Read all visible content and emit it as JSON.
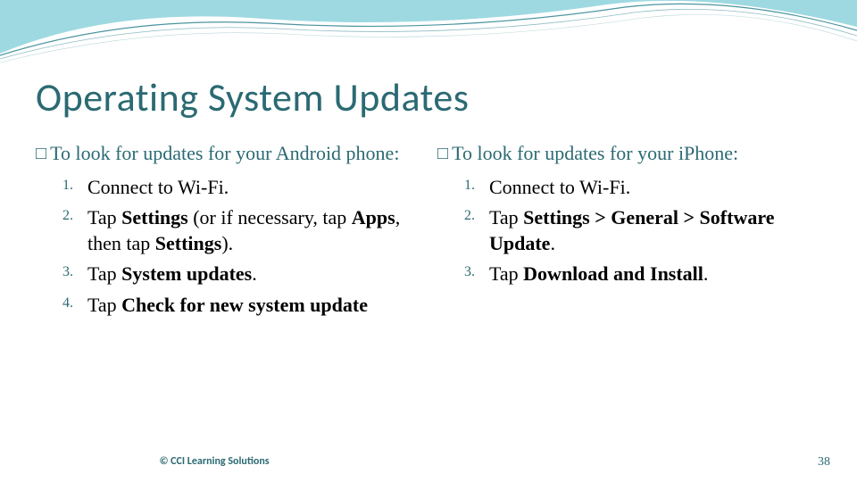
{
  "title": "Operating System Updates",
  "bullet_glyph": "□",
  "left": {
    "intro": "To look for updates for your Android phone:",
    "steps_html": [
      "Connect to Wi-Fi.",
      "Tap <b>Settings</b> (or if necessary, tap <b>Apps</b>, then tap <b>Settings</b>).",
      "Tap <b>System updates</b>.",
      "Tap <b>Check for new system update</b>"
    ]
  },
  "right": {
    "intro": "To look for updates for your iPhone:",
    "steps_html": [
      "Connect to Wi-Fi.",
      "Tap <b>Settings > General > Software Update</b>.",
      "Tap <b>Download and Install</b>."
    ]
  },
  "footer": "© CCI Learning Solutions",
  "page_number": "38"
}
